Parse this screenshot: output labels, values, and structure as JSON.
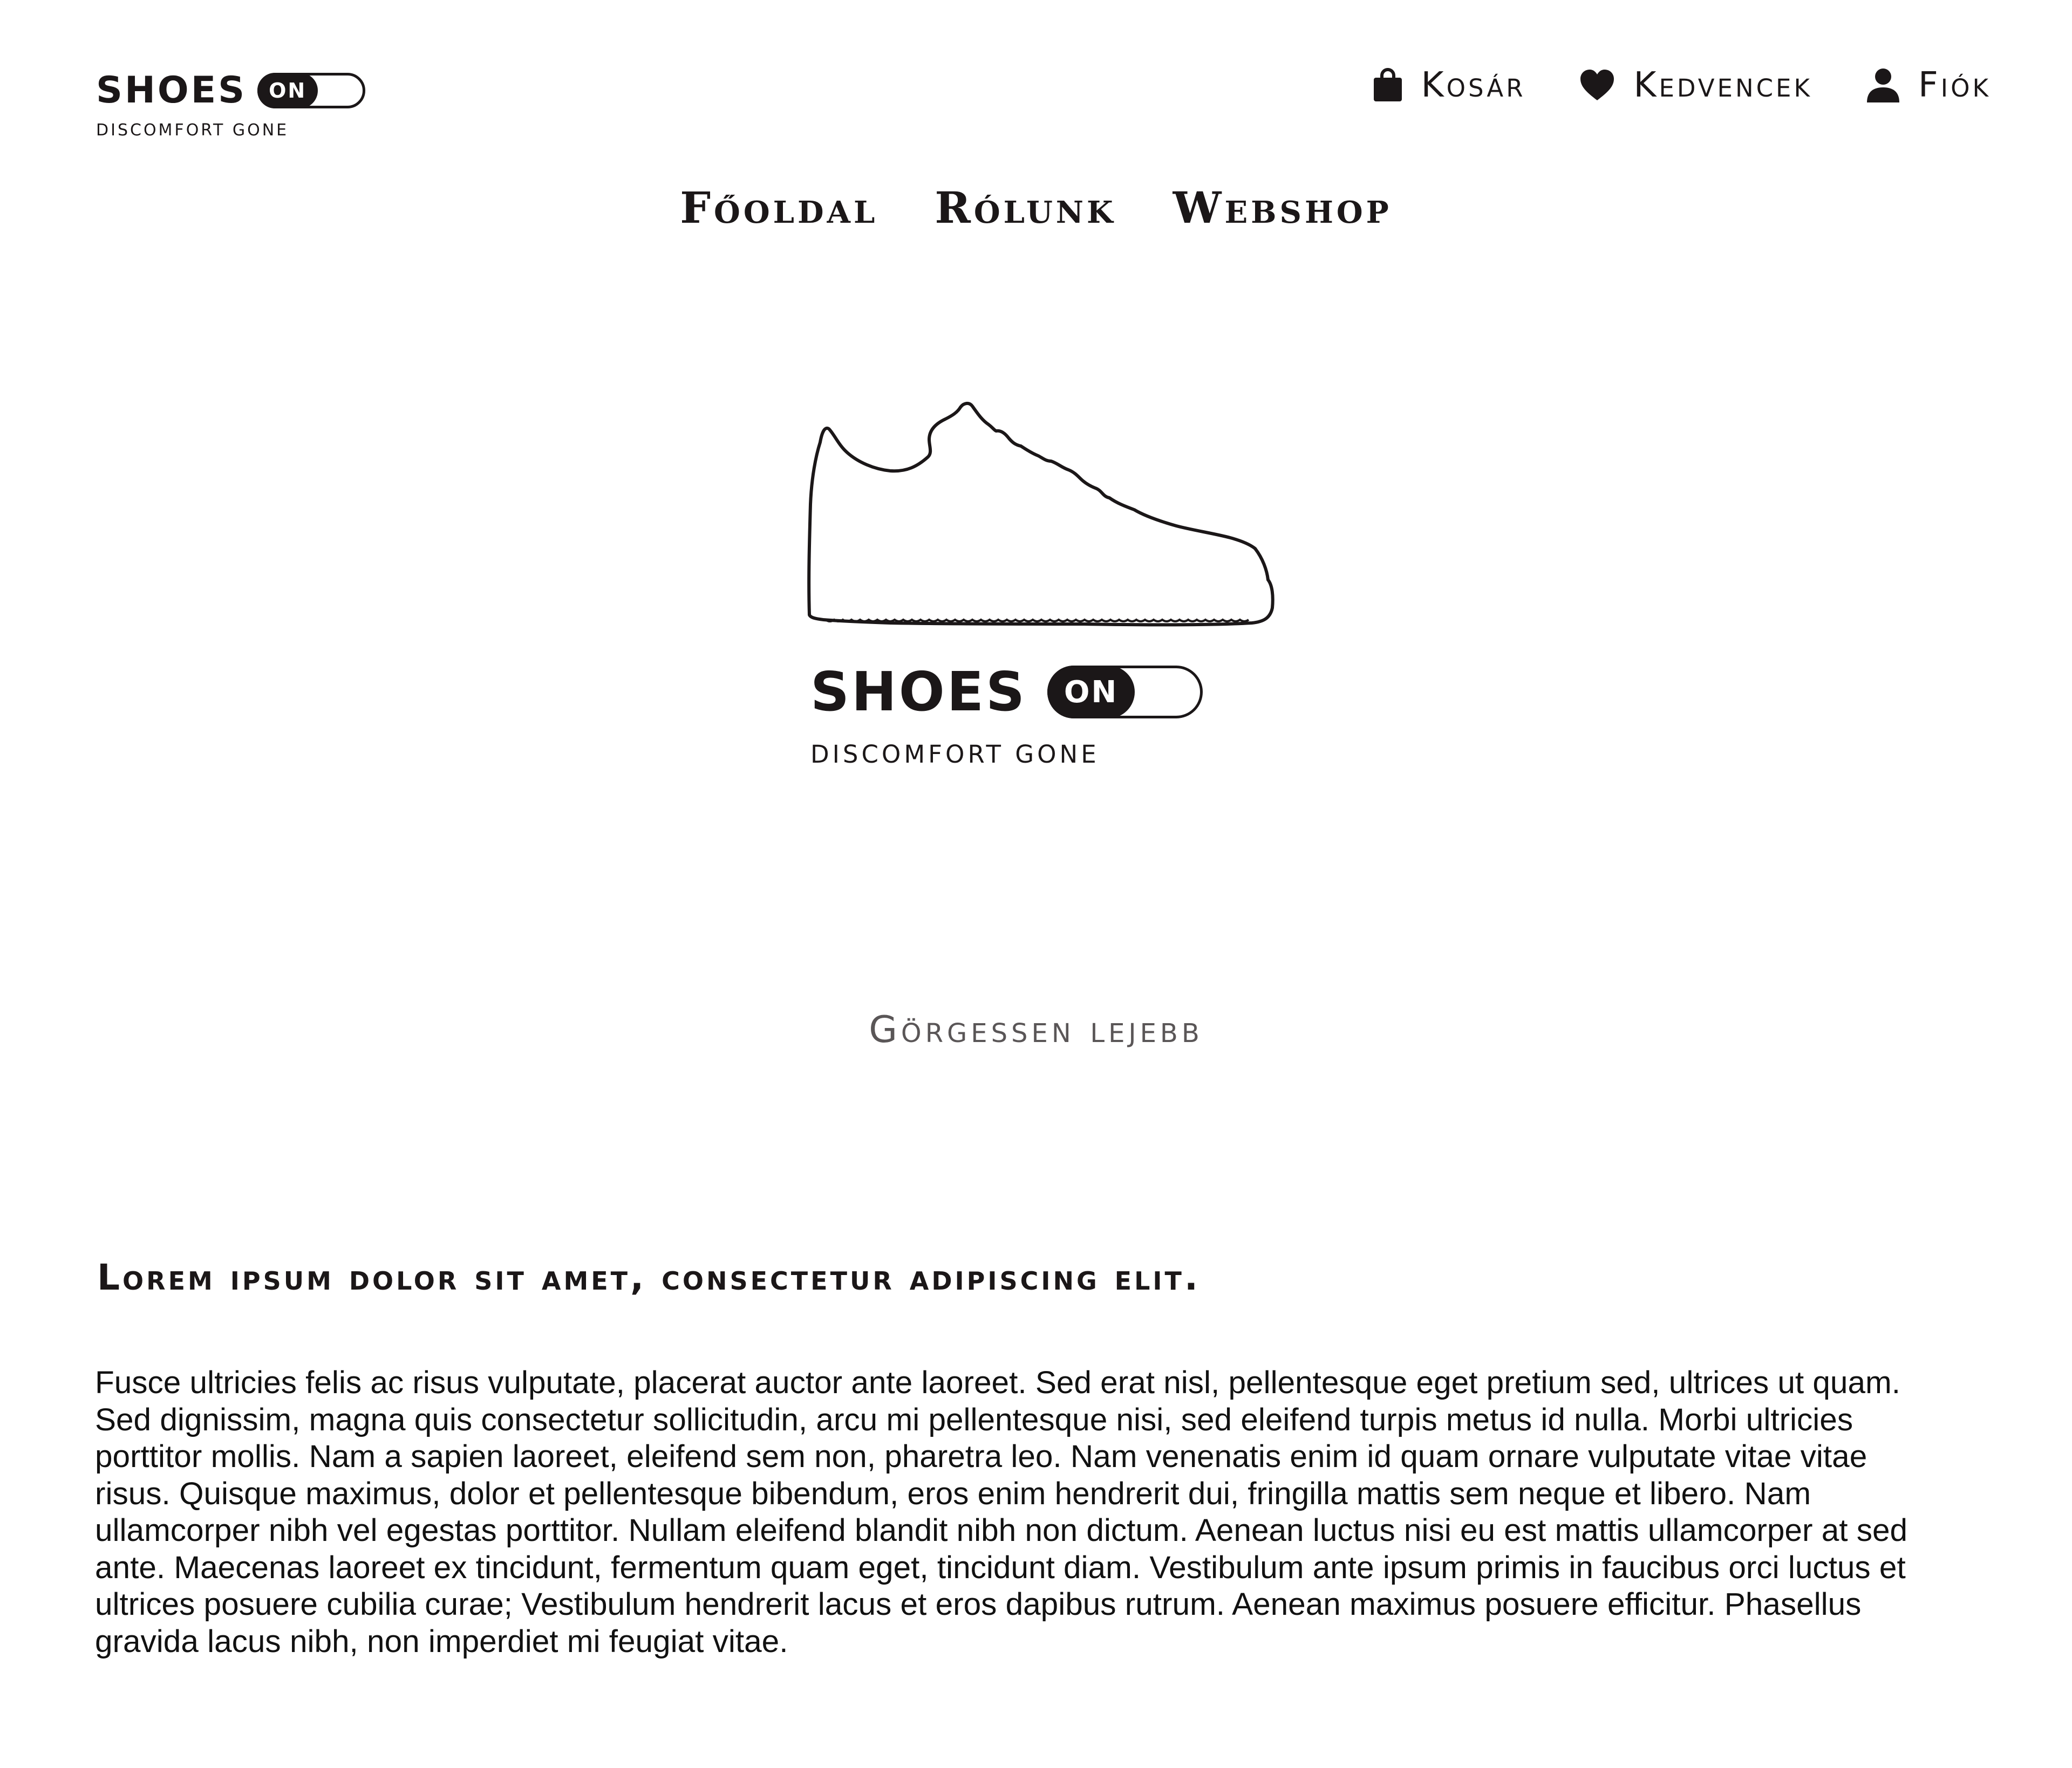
{
  "header": {
    "brand": {
      "word": "SHOES",
      "toggle_label": "ON",
      "tagline": "Discomfort gone"
    },
    "actions": [
      {
        "label": "Kosár",
        "icon": "bag-icon"
      },
      {
        "label": "Kedvencek",
        "icon": "heart-icon"
      },
      {
        "label": "Fiók",
        "icon": "user-icon"
      }
    ]
  },
  "nav": {
    "items": [
      {
        "label": "Főoldal"
      },
      {
        "label": "Rólunk"
      },
      {
        "label": "Webshop"
      }
    ]
  },
  "hero": {
    "illustration": "sneaker-outline-icon",
    "brand": {
      "word": "SHOES",
      "toggle_label": "ON",
      "tagline": "Discomfort gone"
    },
    "scroll_hint": "Görgessen lejebb"
  },
  "content": {
    "headline": "Lorem ipsum dolor sit amet, consectetur adipiscing elit.",
    "body": "Fusce ultricies felis ac risus vulputate, placerat auctor ante laoreet. Sed erat nisl, pellentesque eget pretium sed, ultrices ut quam. Sed dignissim, magna quis consectetur sollicitudin, arcu mi pellentesque nisi, sed eleifend turpis metus id nulla. Morbi ultricies porttitor mollis. Nam a sapien laoreet, eleifend sem non, pharetra leo. Nam venenatis enim id quam ornare vulputate vitae vitae risus. Quisque maximus, dolor et pellentesque bibendum, eros enim hendrerit dui, fringilla mattis sem neque et libero. Nam ullamcorper nibh vel egestas porttitor. Nullam eleifend blandit nibh non dictum. Aenean luctus nisi eu est mattis ullamcorper at sed ante. Maecenas laoreet ex tincidunt, fermentum quam eget, tincidunt diam. Vestibulum ante ipsum primis in faucibus orci luctus et ultrices posuere cubilia curae; Vestibulum hendrerit lacus et eros dapibus rutrum. Aenean maximus posuere efficitur. Phasellus gravida lacus nibh, non imperdiet mi feugiat vitae."
  },
  "colors": {
    "ink": "#1b1718",
    "background": "#ffffff",
    "muted": "#5a5657"
  }
}
